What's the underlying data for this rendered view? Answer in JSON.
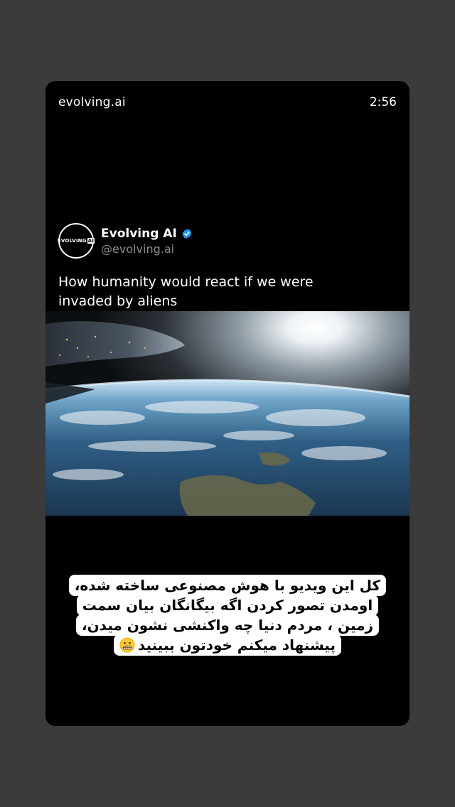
{
  "story": {
    "account": "evolving.ai",
    "time": "2:56"
  },
  "tweet": {
    "avatar_text": "EVOLVING",
    "avatar_badge": "AI",
    "display_name": "Evolving AI",
    "handle": "@evolving.ai",
    "text_line1": "How humanity would react if we were",
    "text_line2": "invaded by aliens"
  },
  "caption": {
    "line1": "کل این ویدیو با هوش مصنوعی ساخته شده،",
    "line2": "اومدن تصور کردن اگه بیگانگان بیان سمت",
    "line3": "زمین ، مردم دنیا چه واکنشی نشون میدن،",
    "line4": "پیشنهاد میکنم خودتون ببینید",
    "emoji": "grimacing-face-icon"
  },
  "colors": {
    "page_bg": "#3b3b3b",
    "verified": "#1d9bf0"
  }
}
